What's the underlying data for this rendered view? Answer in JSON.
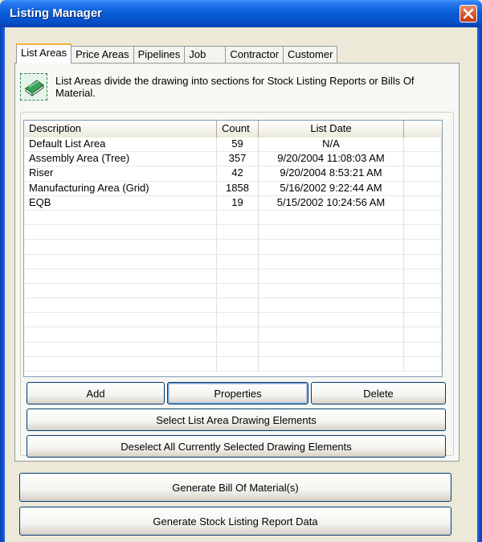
{
  "window": {
    "title": "Listing Manager"
  },
  "tabs": [
    {
      "label": "List Areas"
    },
    {
      "label": "Price Areas"
    },
    {
      "label": "Pipelines"
    },
    {
      "label": "Job"
    },
    {
      "label": "Contractor"
    },
    {
      "label": "Customer"
    }
  ],
  "info": {
    "text": "List Areas divide the drawing into sections for Stock Listing Reports or Bills Of Material.",
    "icon": "book-icon"
  },
  "list": {
    "columns": [
      "Description",
      "Count",
      "List Date",
      ""
    ],
    "rows": [
      {
        "description": "Default List Area",
        "count": "59",
        "date": "N/A"
      },
      {
        "description": "Assembly Area (Tree)",
        "count": "357",
        "date": "9/20/2004 11:08:03 AM"
      },
      {
        "description": "Riser",
        "count": "42",
        "date": "9/20/2004 8:53:21 AM"
      },
      {
        "description": "Manufacturing Area (Grid)",
        "count": "1858",
        "date": "5/16/2002 9:22:44 AM"
      },
      {
        "description": "EQB",
        "count": "19",
        "date": "5/15/2002 10:24:56 AM"
      }
    ],
    "empty_rows": 11
  },
  "buttons": {
    "add": "Add",
    "properties": "Properties",
    "delete": "Delete",
    "select_elements": "Select List Area Drawing Elements",
    "deselect_all": "Deselect All Currently Selected Drawing Elements",
    "generate_bom": "Generate Bill Of Material(s)",
    "generate_stock": "Generate Stock Listing Report Data"
  },
  "colors": {
    "titlebar": "#0a5fd8",
    "close": "#d5522d",
    "tab_accent": "#f7b436"
  }
}
